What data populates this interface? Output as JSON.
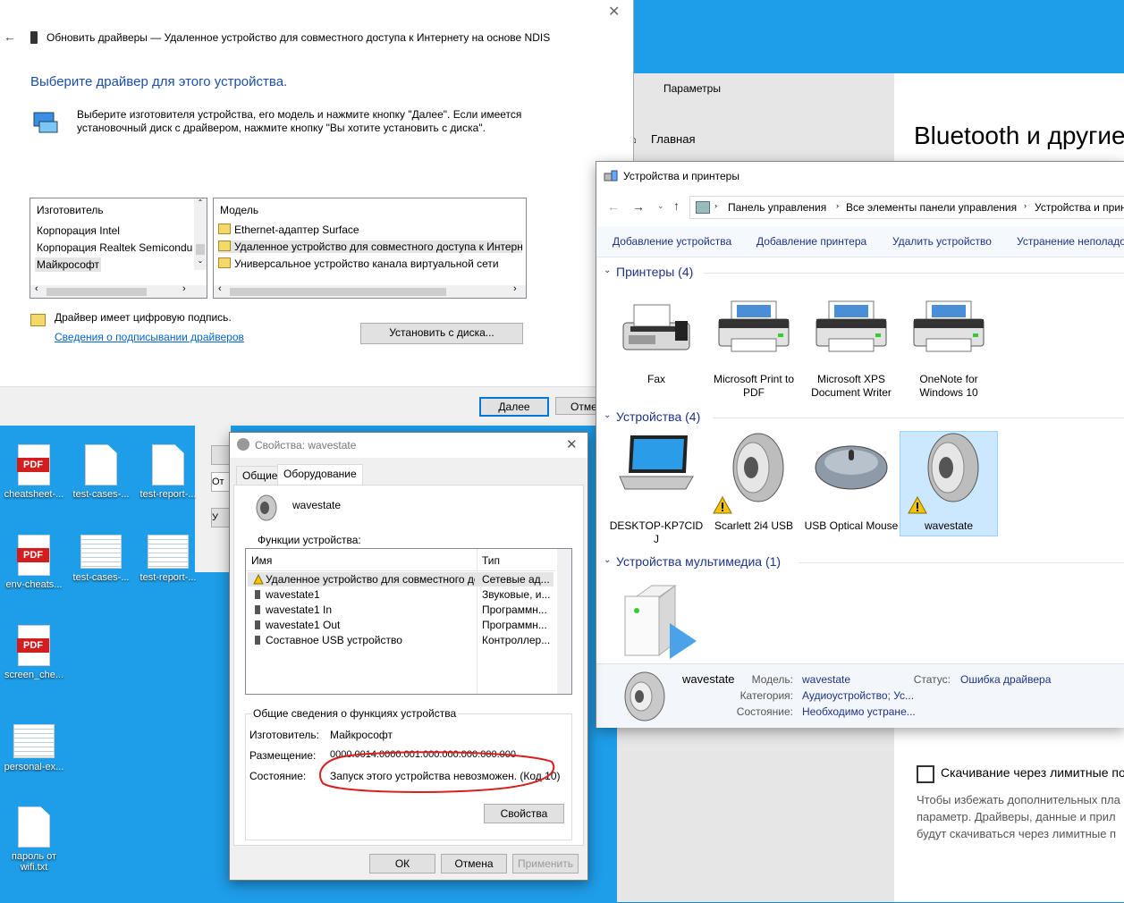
{
  "desktop": {
    "icons": [
      {
        "label": "cheatsheet-...",
        "kind": "pdf",
        "badge": "PDF"
      },
      {
        "label": "test-cases-...",
        "kind": "doc"
      },
      {
        "label": "test-report-...",
        "kind": "doc"
      },
      {
        "label": "env-cheats...",
        "kind": "pdf",
        "badge": "PDF"
      },
      {
        "label": "test-cases-...",
        "kind": "sheet"
      },
      {
        "label": "test-report-...",
        "kind": "sheet"
      },
      {
        "label": "screen_che...",
        "kind": "pdf",
        "badge": "PDF"
      },
      {
        "label": "personal-ex...",
        "kind": "sheet"
      },
      {
        "label": "пароль от wifi.txt",
        "kind": "doc"
      }
    ]
  },
  "settings": {
    "window_title": "Параметры",
    "home_label": "Главная",
    "page_title": "Bluetooth и другие",
    "metered_checkbox_label": "Скачивание через лимитные по",
    "metered_note": [
      "Чтобы избежать дополнительных пла",
      "параметр. Драйверы, данные и прил",
      "будут скачиваться через лимитные п"
    ]
  },
  "wizard": {
    "title": "Обновить драйверы — Удаленное устройство для совместного доступа к Интернету на основе NDIS",
    "heading": "Выберите драйвер для этого устройства.",
    "instructions": [
      "Выберите изготовителя устройства, его модель и нажмите кнопку \"Далее\". Если имеется",
      "установочный диск с драйвером, нажмите кнопку \"Вы хотите установить с диска\"."
    ],
    "manufacturer_header": "Изготовитель",
    "manufacturers": [
      "Корпорация Intel",
      "Корпорация Realtek Semicondu",
      "Майкрософт"
    ],
    "selected_manufacturer": "Майкрософт",
    "model_header": "Модель",
    "models": [
      "Ethernet-адаптер Surface",
      "Удаленное устройство для совместного доступа к Интерне",
      "Универсальное устройство канала виртуальной сети"
    ],
    "signed_text": "Драйвер имеет цифровую подпись.",
    "signing_link": "Сведения о подписывании драйверов",
    "have_disk_button": "Установить с диска...",
    "next_button": "Далее",
    "cancel_button": "Отме"
  },
  "devices": {
    "window_title": "Устройства и принтеры",
    "breadcrumb": [
      "Панель управления",
      "Все элементы панели управления",
      "Устройства и прин"
    ],
    "toolbar": [
      "Добавление устройства",
      "Добавление принтера",
      "Удалить устройство",
      "Устранение неполадо"
    ],
    "printers_header": "Принтеры (4)",
    "printers": [
      {
        "name": "Fax",
        "icon": "fax-icon"
      },
      {
        "name": "Microsoft Print to PDF",
        "icon": "printer-icon"
      },
      {
        "name": "Microsoft XPS Document Writer",
        "icon": "printer-icon"
      },
      {
        "name": "OneNote for Windows 10",
        "icon": "printer-icon"
      }
    ],
    "devices_header": "Устройства (4)",
    "devices": [
      {
        "name": "DESKTOP-KP7CIDJ",
        "icon": "laptop-icon",
        "warning": false
      },
      {
        "name": "Scarlett 2i4 USB",
        "icon": "speaker-icon",
        "warning": true
      },
      {
        "name": "USB Optical Mouse",
        "icon": "mouse-icon",
        "warning": false
      },
      {
        "name": "wavestate",
        "icon": "speaker-icon",
        "warning": true,
        "selected": true
      }
    ],
    "multimedia_header": "Устройства мультимедиа (1)",
    "details": {
      "name": "wavestate",
      "model_label": "Модель:",
      "model_value": "wavestate",
      "category_label": "Категория:",
      "category_value": "Аудиоустройство; Ус...",
      "state_label": "Состояние:",
      "state_value": "Необходимо устране...",
      "status_label": "Статус:",
      "status_value": "Ошибка драйвера"
    }
  },
  "props": {
    "title": "Свойства: wavestate",
    "tabs": [
      "Общие",
      "Оборудование"
    ],
    "device_name": "wavestate",
    "functions_label": "Функции устройства:",
    "col_name": "Имя",
    "col_type": "Тип",
    "rows": [
      {
        "name": "Удаленное устройство для совместного до...",
        "type": "Сетевые ад...",
        "selected": true
      },
      {
        "name": "wavestate1",
        "type": "Звуковые, и..."
      },
      {
        "name": "wavestate1 In",
        "type": "Программн..."
      },
      {
        "name": "wavestate1 Out",
        "type": "Программн..."
      },
      {
        "name": "Составное USB устройство",
        "type": "Контроллер..."
      }
    ],
    "summary_label": "Общие сведения о функциях устройства",
    "manufacturer_label": "Изготовитель:",
    "manufacturer_value": "Майкрософт",
    "location_label": "Размещение:",
    "location_value": "0000.0014.0000.001.000.000.000.000.000",
    "status_label": "Состояние:",
    "status_value": "Запуск этого устройства невозможен. (Код 10)",
    "properties_button": "Свойства",
    "ok_button": "ОК",
    "cancel_button": "Отмена",
    "apply_button": "Применить"
  },
  "colors": {
    "desktop": "#1e9de8",
    "link": "#0066cc",
    "heading": "#1e3287",
    "annotation": "#d81e1e"
  }
}
